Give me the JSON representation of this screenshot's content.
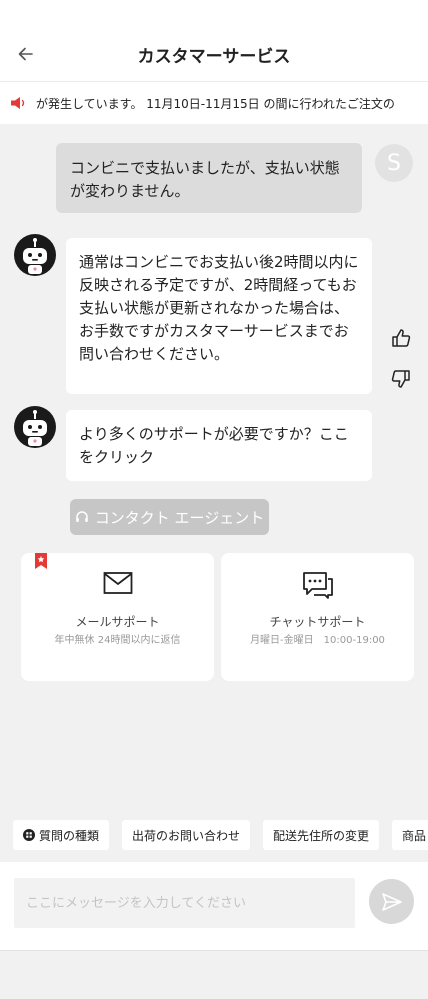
{
  "header": {
    "title": "カスタマーサービス",
    "back_icon": "arrow-left-icon"
  },
  "notice": {
    "icon": "speaker-icon",
    "text": "が発生しています。 11月10日-11月15日 の間に行われたご注文の",
    "accent": "#e53935"
  },
  "messages": {
    "user_1": "コンビニで支払いましたが、支払い状態が変わりません。",
    "user_avatar_initial": "S",
    "bot_1": "通常はコンビニでお支払い後2時間以内に反映される予定ですが、2時間経ってもお支払い状態が更新されなかった場合は、お手数ですがカスタマーサービスまでお問い合わせください。",
    "bot_2": "より多くのサポートが必要ですか？ここをクリック"
  },
  "contact_agent": {
    "label": "コンタクト エージェント",
    "icon": "headset-icon"
  },
  "cards": {
    "mail": {
      "icon": "envelope-icon",
      "title": "メールサポート",
      "subtitle": "年中無休 24時間以内に返信"
    },
    "chat": {
      "icon": "chat-icon",
      "title": "チャットサポート",
      "subtitle": "月曜日-金曜日　10:00-19:00"
    }
  },
  "quick_replies": [
    {
      "label": "質問の種類"
    },
    {
      "label": "出荷のお問い合わせ"
    },
    {
      "label": "配送先住所の変更"
    },
    {
      "label": "商品"
    }
  ],
  "composer": {
    "placeholder": "ここにメッセージを入力してください",
    "send_icon": "send-icon"
  },
  "colors": {
    "brand_red": "#e53935",
    "bubble_user": "#dcdcdc",
    "background": "#f1f1f1"
  }
}
